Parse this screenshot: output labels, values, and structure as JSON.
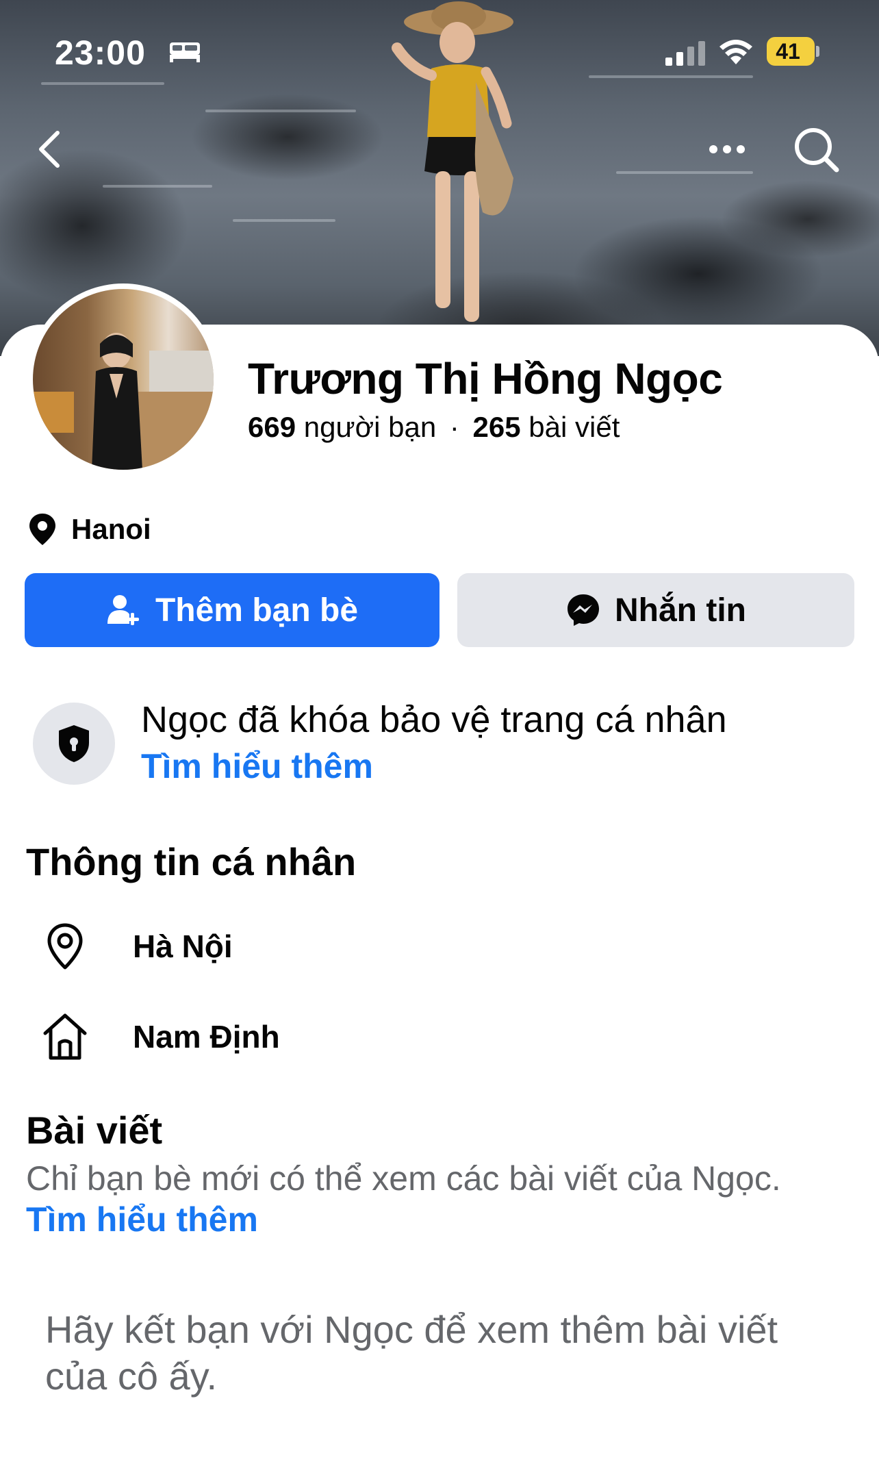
{
  "status_bar": {
    "time": "23:00",
    "battery": "41",
    "icons": [
      "bed-icon",
      "cellular-signal-icon",
      "wifi-icon",
      "battery-icon"
    ]
  },
  "nav": {
    "back_icon": "chevron-left-icon",
    "more_icon": "more-horizontal-icon",
    "search_icon": "search-icon"
  },
  "profile": {
    "name": "Trương Thị Hồng Ngọc",
    "friends_count": "669",
    "friends_label": "người bạn",
    "separator": "·",
    "posts_count": "265",
    "posts_label": "bài viết",
    "location": "Hanoi"
  },
  "actions": {
    "add_friend_label": "Thêm bạn bè",
    "message_label": "Nhắn tin"
  },
  "privacy": {
    "title": "Ngọc đã khóa bảo vệ trang cá nhân",
    "link": "Tìm hiểu thêm"
  },
  "about": {
    "title": "Thông tin cá nhân",
    "items": [
      {
        "icon": "location-pin-icon",
        "label": "Hà Nội"
      },
      {
        "icon": "home-icon",
        "label": "Nam Định"
      }
    ]
  },
  "posts": {
    "title": "Bài viết",
    "subtitle": "Chỉ bạn bè mới có thể xem các bài viết của Ngọc.",
    "link": "Tìm hiểu thêm",
    "friend_prompt": "Hãy kết bạn với Ngọc để xem thêm bài viết của cô ấy."
  },
  "colors": {
    "primary_blue": "#1e6df6",
    "link_blue": "#1877f2",
    "secondary_button": "#e4e6eb",
    "muted_text": "#65676b",
    "battery_yellow": "#f4d03f"
  }
}
